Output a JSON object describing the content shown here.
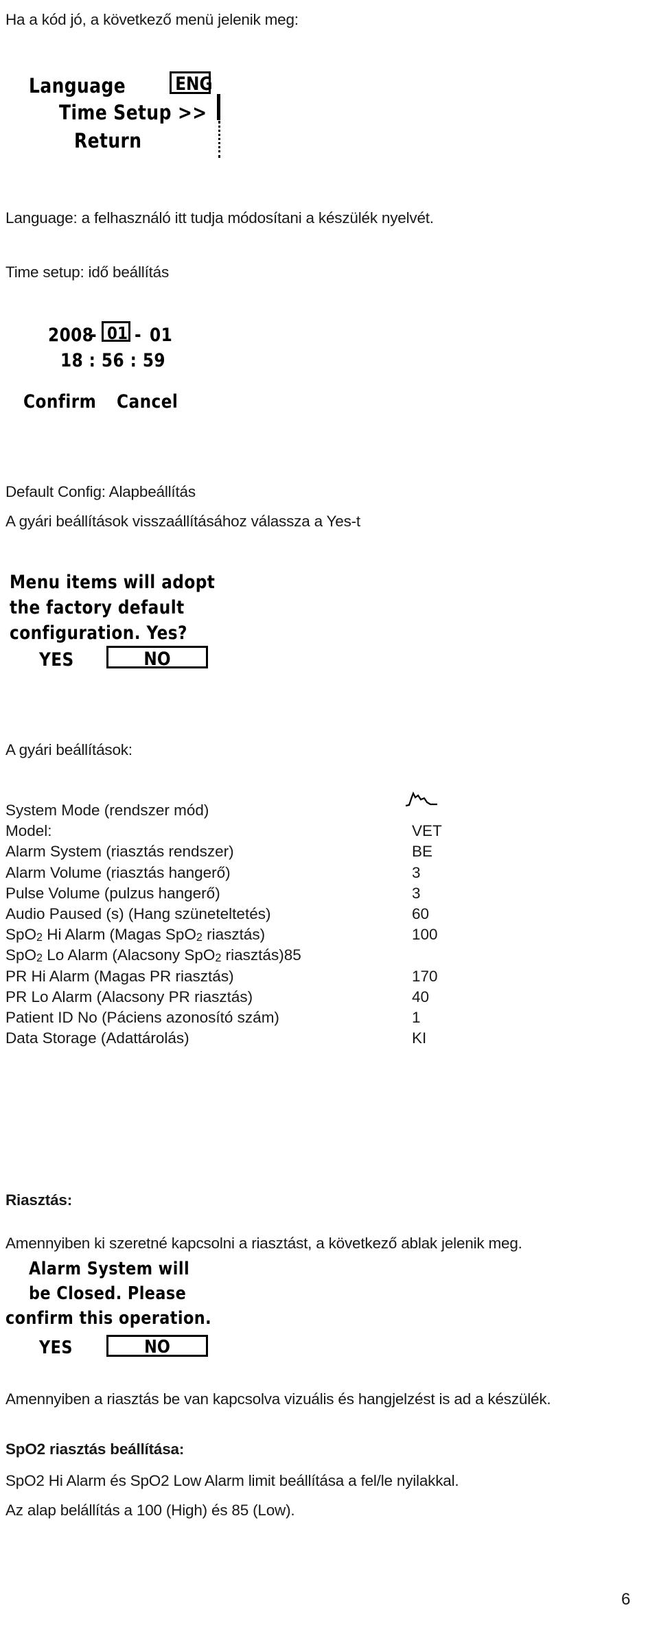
{
  "document": {
    "page_number": "6",
    "intro_line": "Ha a kód jó, a következő menü jelenik meg:"
  },
  "menu_screen": {
    "name": "main-setup-menu",
    "items": [
      {
        "label": "Language",
        "value": "ENG",
        "selected": true
      },
      {
        "label": "Time Setup >>",
        "value": "",
        "selected": false
      },
      {
        "label": "Return",
        "value": "",
        "selected": false
      }
    ]
  },
  "descriptions": {
    "language": "Language: a felhasználó itt tudja módosítani a készülék nyelvét.",
    "time_setup": "Time setup: idő beállítás",
    "default_config": "Default Config: Alapbeállítás",
    "factory_restore": "A gyári beállítások visszaállításához válassza a Yes-t",
    "factory_list_heading": "A gyári beállítások:"
  },
  "time_screen": {
    "name": "time-setup-screen",
    "date": {
      "year": "2008",
      "sep1": "-",
      "month": "01",
      "sep2": "-",
      "day": "01"
    },
    "time": "18 : 56 : 59",
    "buttons": [
      {
        "label": "Confirm"
      },
      {
        "label": "Cancel"
      }
    ]
  },
  "default_config_screen": {
    "name": "factory-default-confirm-dialog",
    "lines": [
      "Menu items will adopt",
      "the factory default",
      "configuration. Yes?"
    ],
    "buttons": [
      {
        "label": "YES",
        "selected": false
      },
      {
        "label": "NO",
        "selected": true
      }
    ]
  },
  "factory_settings": {
    "waveform_icon": "pulse-waveform-icon",
    "rows": [
      {
        "label": "System Mode (rendszer mód)",
        "value": "",
        "inline": false
      },
      {
        "label": "Model:",
        "value": "VET",
        "inline": false
      },
      {
        "label": "Alarm System (riasztás rendszer)",
        "value": "BE",
        "inline": false
      },
      {
        "label": "Alarm Volume (riasztás hangerő)",
        "value": "3",
        "inline": false
      },
      {
        "label": "Pulse Volume (pulzus hangerő)",
        "value": "3",
        "inline": false
      },
      {
        "label": "Audio Paused (s) (Hang szüneteltetés)",
        "value": "60",
        "inline": false
      },
      {
        "label": "SpO2 Hi Alarm (Magas SpO2 riasztás)",
        "value": "100",
        "inline": false,
        "sub": true
      },
      {
        "label": "SpO2 Lo Alarm (Alacsony SpO2 riasztás)",
        "value": "85",
        "inline": true,
        "sub": true
      },
      {
        "label": "PR Hi Alarm (Magas PR riasztás)",
        "value": "170",
        "inline": false
      },
      {
        "label": "PR Lo Alarm (Alacsony PR riasztás)",
        "value": "40",
        "inline": false
      },
      {
        "label": "Patient ID No (Páciens azonosító szám)",
        "value": "1",
        "inline": false
      },
      {
        "label": "Data Storage (Adattárolás)",
        "value": "KI",
        "inline": false
      }
    ]
  },
  "alarm_section": {
    "heading": "Riasztás:",
    "intro": "Amennyiben ki szeretné kapcsolni a riasztást, a következő ablak jelenik meg.",
    "dialog": {
      "name": "alarm-close-confirm-dialog",
      "lines": [
        "Alarm System will",
        "be Closed. Please",
        "confirm this operation."
      ],
      "buttons": [
        {
          "label": "YES",
          "selected": false
        },
        {
          "label": "NO",
          "selected": true
        }
      ]
    },
    "note": "Amennyiben a riasztás be van kapcsolva vizuális és hangjelzést is ad a készülék."
  },
  "spo2_section": {
    "heading": "SpO2 riasztás beállítása:",
    "line1": "SpO2 Hi Alarm és SpO2 Low Alarm limit beállítása a fel/le nyilakkal.",
    "line2": "Az alap belállítás a 100 (High) és 85 (Low)."
  }
}
